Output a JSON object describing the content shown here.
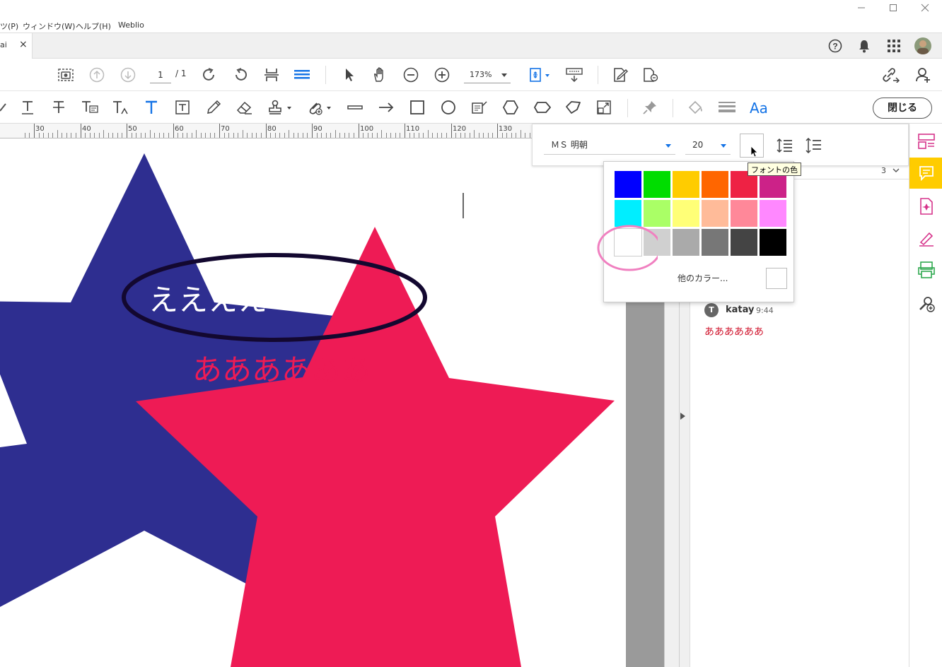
{
  "menubar": {
    "items": [
      "ツ(P)",
      "ウィンドウ(W)",
      "ヘルプ(H)",
      "Weblio"
    ]
  },
  "tab": {
    "label": "ai",
    "close": "×"
  },
  "toolbar": {
    "page_current": "1",
    "page_total": "/ 1",
    "zoom": "173%",
    "close_button": "閉じる"
  },
  "ruler": {
    "labels": [
      "30",
      "40",
      "50",
      "60",
      "70",
      "80",
      "90",
      "100",
      "110",
      "120",
      "130"
    ]
  },
  "format_bar": {
    "font_name": "ＭＳ 明朝",
    "font_size": "20"
  },
  "tooltip": "フォントの色",
  "color_popup": {
    "more_colors": "他のカラー...",
    "swatches": [
      "#0000ff",
      "#00dd00",
      "#ffcc00",
      "#ff6600",
      "#ee2244",
      "#cc2288",
      "#00eeff",
      "#aaff66",
      "#ffff77",
      "#ffbb99",
      "#ff8899",
      "#ff88ff",
      "#ffffff",
      "#d0d0d0",
      "#aaaaaa",
      "#777777",
      "#444444",
      "#000000"
    ],
    "highlight_color": "#f080c0"
  },
  "canvas": {
    "text_white": "ええええ",
    "text_pink": "ああああああ",
    "blue_star_color": "#2e2e90",
    "pink_star_color": "#ee1b55"
  },
  "comments": {
    "count": "3",
    "author": "katay",
    "author_initial": "T",
    "time": "9:44",
    "text": "ああああああ"
  },
  "colors": {
    "accent": "#1473e6",
    "comment_yellow": "#ffcc00",
    "comment_text": "#d0142c"
  }
}
